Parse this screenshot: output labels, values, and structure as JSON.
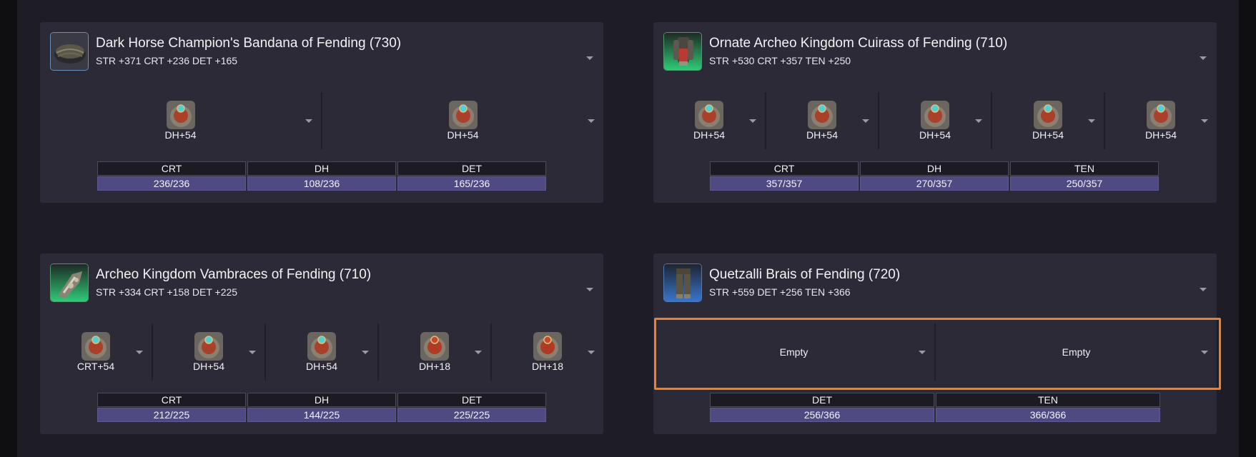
{
  "cards": [
    {
      "name": "Dark Horse Champion's Bandana of Fending (730)",
      "stats": "STR +371 CRT +236 DET +165",
      "icon": "bandana-icon",
      "slots": [
        {
          "label": "DH+54",
          "icon": "materia-icon"
        },
        {
          "label": "DH+54",
          "icon": "materia-icon"
        }
      ],
      "substats": [
        {
          "name": "CRT",
          "value": "236/236"
        },
        {
          "name": "DH",
          "value": "108/236"
        },
        {
          "name": "DET",
          "value": "165/236"
        }
      ]
    },
    {
      "name": "Ornate Archeo Kingdom Cuirass of Fending (710)",
      "stats": "STR +530 CRT +357 TEN +250",
      "icon": "cuirass-icon",
      "slots": [
        {
          "label": "DH+54",
          "icon": "materia-icon"
        },
        {
          "label": "DH+54",
          "icon": "materia-icon"
        },
        {
          "label": "DH+54",
          "icon": "materia-icon"
        },
        {
          "label": "DH+54",
          "icon": "materia-icon"
        },
        {
          "label": "DH+54",
          "icon": "materia-icon"
        }
      ],
      "substats": [
        {
          "name": "CRT",
          "value": "357/357"
        },
        {
          "name": "DH",
          "value": "270/357"
        },
        {
          "name": "TEN",
          "value": "250/357"
        }
      ]
    },
    {
      "name": "Archeo Kingdom Vambraces of Fending (710)",
      "stats": "STR +334 CRT +158 DET +225",
      "icon": "vambraces-icon",
      "slots": [
        {
          "label": "CRT+54",
          "icon": "materia-icon"
        },
        {
          "label": "DH+54",
          "icon": "materia-icon"
        },
        {
          "label": "DH+54",
          "icon": "materia-icon"
        },
        {
          "label": "DH+18",
          "icon": "materia-icon"
        },
        {
          "label": "DH+18",
          "icon": "materia-icon"
        }
      ],
      "substats": [
        {
          "name": "CRT",
          "value": "212/225"
        },
        {
          "name": "DH",
          "value": "144/225"
        },
        {
          "name": "DET",
          "value": "225/225"
        }
      ]
    },
    {
      "name": "Quetzalli Brais of Fending (720)",
      "stats": "STR +559 DET +256 TEN +366",
      "icon": "brais-icon",
      "slots": [
        {
          "label": "Empty"
        },
        {
          "label": "Empty"
        }
      ],
      "substats": [
        {
          "name": "DET",
          "value": "256/366"
        },
        {
          "name": "TEN",
          "value": "366/366"
        }
      ]
    }
  ],
  "colors": {
    "highlight": "#f07f2a",
    "stat_bar": "#4f4a82",
    "card_bg": "#2b2a36"
  }
}
